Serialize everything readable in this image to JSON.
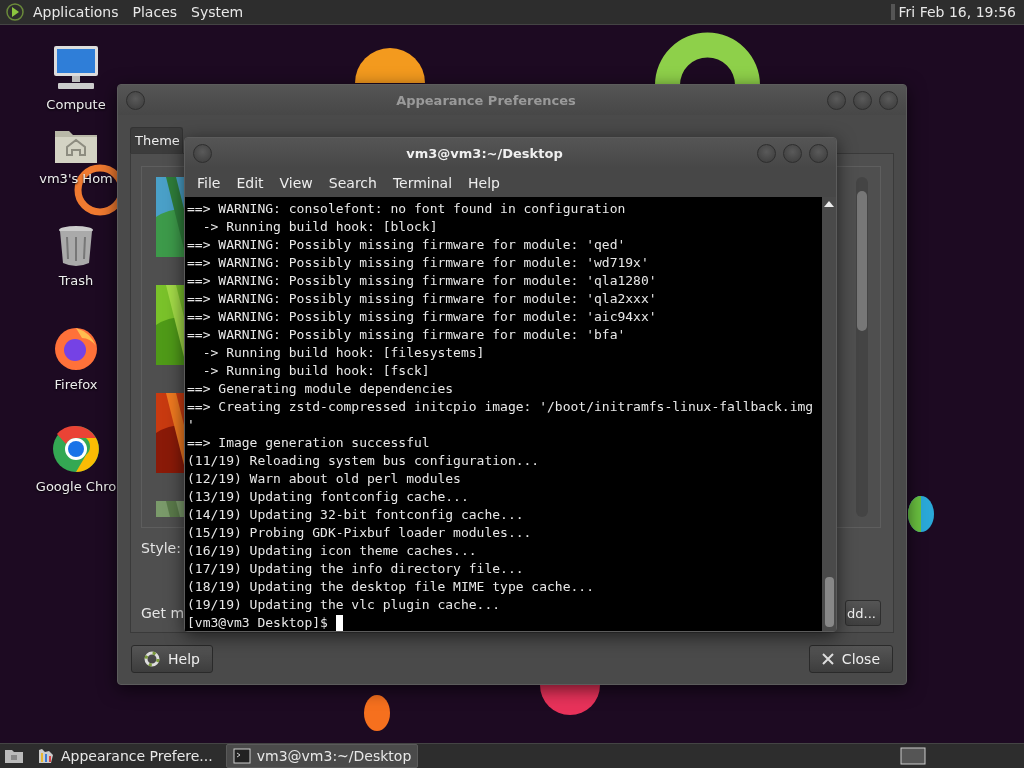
{
  "top_panel": {
    "menus": [
      "Applications",
      "Places",
      "System"
    ],
    "clock": "Fri Feb 16, 19:56"
  },
  "desktop_icons": [
    {
      "label": "Compute",
      "kind": "computer"
    },
    {
      "label": "vm3's Hom",
      "kind": "home"
    },
    {
      "label": "Trash",
      "kind": "trash"
    },
    {
      "label": "Firefox",
      "kind": "firefox"
    },
    {
      "label": "Google Chro",
      "kind": "chrome"
    }
  ],
  "appearance_window": {
    "title": "Appearance Preferences",
    "tabs": [
      {
        "label": "Theme",
        "selected": false
      }
    ],
    "style_label": "Style:",
    "get_more_label": "Get m",
    "add_button": "dd...",
    "help_button": "Help",
    "close_button": "Close"
  },
  "terminal_window": {
    "title": "vm3@vm3:~/Desktop",
    "menu": [
      "File",
      "Edit",
      "View",
      "Search",
      "Terminal",
      "Help"
    ],
    "lines": [
      "==> WARNING: consolefont: no font found in configuration",
      "  -> Running build hook: [block]",
      "==> WARNING: Possibly missing firmware for module: 'qed'",
      "==> WARNING: Possibly missing firmware for module: 'wd719x'",
      "==> WARNING: Possibly missing firmware for module: 'qla1280'",
      "==> WARNING: Possibly missing firmware for module: 'qla2xxx'",
      "==> WARNING: Possibly missing firmware for module: 'aic94xx'",
      "==> WARNING: Possibly missing firmware for module: 'bfa'",
      "  -> Running build hook: [filesystems]",
      "  -> Running build hook: [fsck]",
      "==> Generating module dependencies",
      "==> Creating zstd-compressed initcpio image: '/boot/initramfs-linux-fallback.img",
      "'",
      "==> Image generation successful",
      "(11/19) Reloading system bus configuration...",
      "(12/19) Warn about old perl modules",
      "(13/19) Updating fontconfig cache...",
      "(14/19) Updating 32-bit fontconfig cache...",
      "(15/19) Probing GDK-Pixbuf loader modules...",
      "(16/19) Updating icon theme caches...",
      "(17/19) Updating the info directory file...",
      "(18/19) Updating the desktop file MIME type cache...",
      "(19/19) Updating the vlc plugin cache..."
    ],
    "prompt": "[vm3@vm3 Desktop]$"
  },
  "taskbar": {
    "tasks": [
      {
        "label": "Appearance Prefere...",
        "kind": "appearance",
        "selected": false
      },
      {
        "label": "vm3@vm3:~/Desktop",
        "kind": "terminal",
        "selected": true
      }
    ]
  }
}
